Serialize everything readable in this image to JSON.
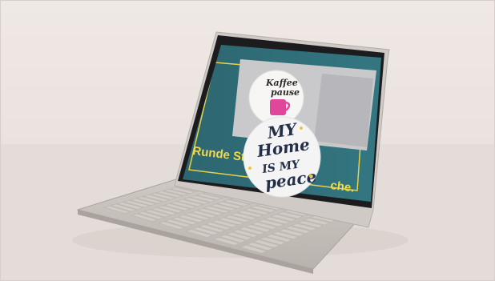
{
  "caption": {
    "left": "Runde Stick",
    "right": "che."
  },
  "sticker_kaffee": {
    "line1": "Kaffee",
    "line2": "pause"
  },
  "sticker_home": {
    "line1": "MY",
    "line2": "Home",
    "line3": "IS MY",
    "line4": "peace"
  },
  "colors": {
    "background": "#ece5e1",
    "screen_teal": "#2f6a73",
    "caption_yellow": "#f2d84a",
    "keyboard": "#c8c2bd"
  }
}
